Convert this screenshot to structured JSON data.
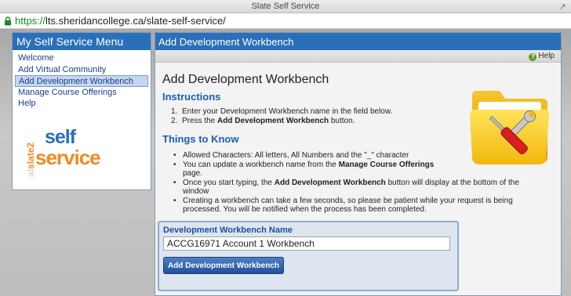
{
  "window": {
    "title": "Slate Self Service",
    "url_protocol": "https://",
    "url_rest": "lts.sheridancollege.ca/slate-self-service/"
  },
  "menu": {
    "title": "My Self Service Menu",
    "items": [
      {
        "label": "Welcome",
        "active": false
      },
      {
        "label": "Add Virtual Community",
        "active": false
      },
      {
        "label": "Add Development Workbench",
        "active": true
      },
      {
        "label": "Manage Course Offerings",
        "active": false
      },
      {
        "label": "Help",
        "active": false
      }
    ],
    "logo": {
      "vertical_text": "slate2",
      "vertical_prefix": "al",
      "word1": "self",
      "word2": "service"
    }
  },
  "panel": {
    "header": "Add Development Workbench",
    "help_label": "Help",
    "title": "Add Development Workbench",
    "instructions_heading": "Instructions",
    "steps": [
      {
        "num": "1.",
        "text": "Enter your Development Workbench name in the field below."
      },
      {
        "num": "2.",
        "text_before": "Press the ",
        "bold": "Add Development Workbench",
        "text_after": " button."
      }
    ],
    "know_heading": "Things to Know",
    "rules": [
      {
        "text": "Allowed Characters: All letters, All Numbers and the \"_\" character"
      },
      {
        "text_before": "You can update a workbench name from the ",
        "bold": "Manage Course Offerings",
        "text_after": " page."
      },
      {
        "text_before": "Once you start typing, the ",
        "bold": "Add Development Workbench",
        "text_after": " button will display at the bottom of the window"
      },
      {
        "text": "Creating a workbench can take a few seconds, so please be patient while your request is being processed. You will be notified when the process has been completed."
      }
    ]
  },
  "form": {
    "label": "Development Workbench Name",
    "value": "ACCG16971 Account 1 Workbench",
    "button": "Add Development Workbench"
  },
  "colors": {
    "header_blue": "#2a6fba",
    "link_blue": "#1a3d8c",
    "heading_blue": "#1b5fb0",
    "logo_orange": "#f08a24",
    "url_green": "#1a8a1a"
  }
}
